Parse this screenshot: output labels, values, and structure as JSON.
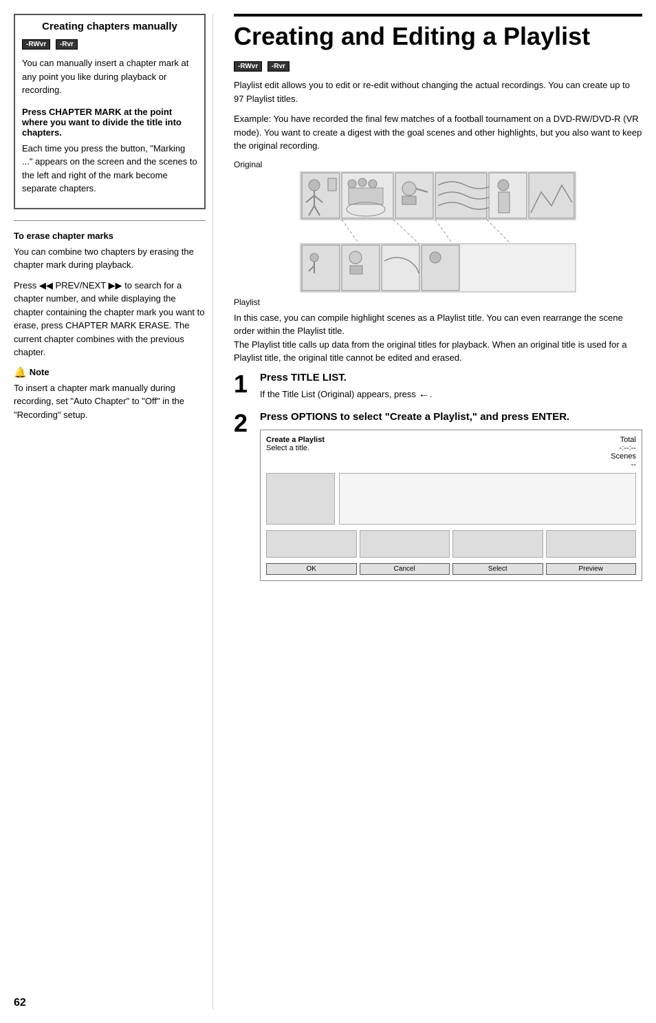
{
  "left": {
    "section_title": "Creating chapters manually",
    "badges": [
      "-RWvr",
      "-Rvr"
    ],
    "intro_text": "You can manually insert a chapter mark at any point you like during playback or recording.",
    "press_chapter_title": "Press CHAPTER MARK at the point where you want to divide the title into chapters.",
    "press_chapter_body": "Each time you press the button, \"Marking ...\" appears on the screen and the scenes to the left and right of the mark become separate chapters.",
    "erase_title": "To erase chapter marks",
    "erase_body1": "You can combine two chapters by erasing the chapter mark during playback.",
    "erase_body2": "Press ◀◀ PREV/NEXT ▶▶ to search for a chapter number, and while displaying the chapter containing the chapter mark you want to erase, press CHAPTER MARK ERASE. The current chapter combines with the previous chapter.",
    "note_label": "Note",
    "note_body": "To insert a chapter mark manually during recording, set \"Auto Chapter\" to \"Off\" in the \"Recording\" setup."
  },
  "right": {
    "big_title": "Creating and Editing a Playlist",
    "badges": [
      "-RWvr",
      "-Rvr"
    ],
    "intro1": "Playlist edit allows you to edit or re-edit without changing the actual recordings. You can create up to 97 Playlist titles.",
    "intro2": "Example: You have recorded the final few matches of a football tournament on a DVD-RW/DVD-R (VR mode). You want to create a digest with the goal scenes and other highlights, but you also want to keep the original recording.",
    "diagram_label_original": "Original",
    "diagram_label_playlist": "Playlist",
    "body_after_diagram": "In this case, you can compile highlight scenes as a Playlist title. You can even rearrange the scene order within the Playlist title.\nThe Playlist title calls up data from the original titles for playback. When an original title is used for a Playlist title, the original title cannot be edited and erased.",
    "step1_number": "1",
    "step1_title": "Press TITLE LIST.",
    "step1_body": "If the Title List (Original) appears, press",
    "step1_arrow": "←",
    "step2_number": "2",
    "step2_title": "Press OPTIONS to select \"Create a Playlist,\" and press ENTER.",
    "ui": {
      "header_title": "Create a Playlist",
      "header_sub": "Select a title.",
      "total_label": "Total",
      "total_value": "-:--:--",
      "scenes_label": "Scenes",
      "scenes_value": "--",
      "btn_ok": "OK",
      "btn_cancel": "Cancel",
      "btn_select": "Select",
      "btn_preview": "Preview"
    }
  },
  "page_number": "62"
}
